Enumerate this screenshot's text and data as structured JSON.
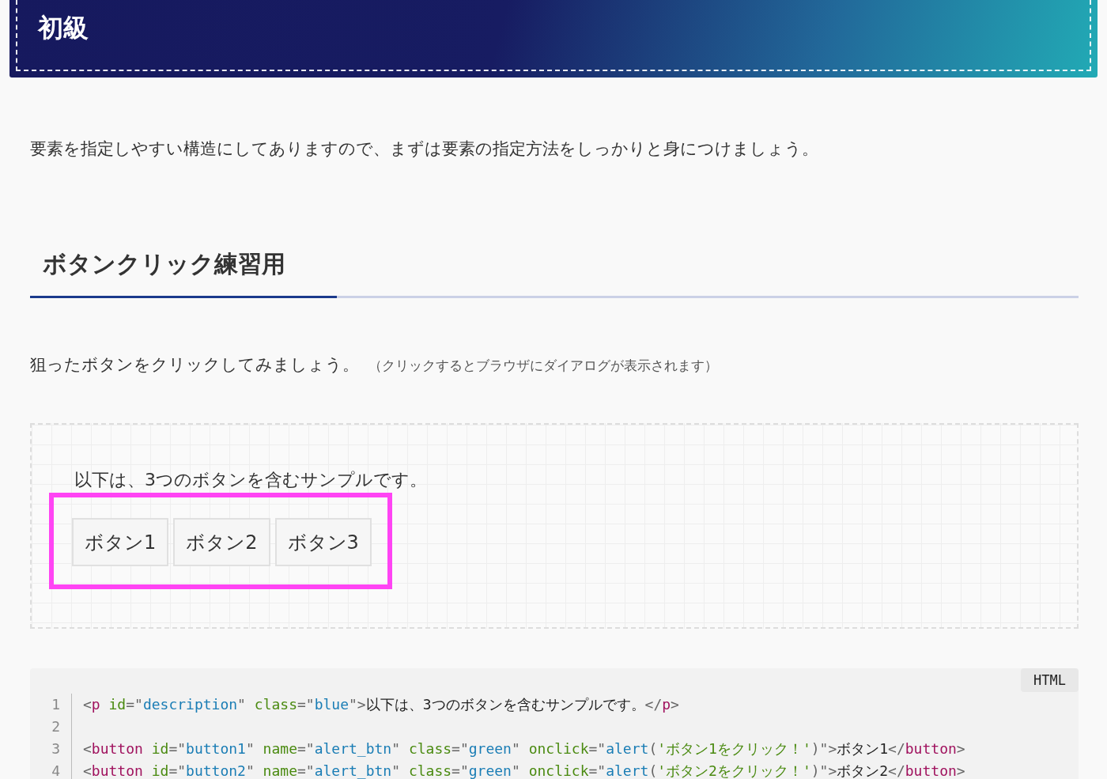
{
  "header": {
    "title": "初級"
  },
  "intro": "要素を指定しやすい構造にしてありますので、まずは要素の指定方法をしっかりと身につけましょう。",
  "section": {
    "heading": "ボタンクリック練習用",
    "instruction": "狙ったボタンをクリックしてみましょう。",
    "note": "（クリックするとブラウザにダイアログが表示されます）"
  },
  "demo": {
    "description": "以下は、3つのボタンを含むサンプルです。",
    "buttons": [
      "ボタン1",
      "ボタン2",
      "ボタン3"
    ]
  },
  "code": {
    "language": "HTML",
    "lines": [
      {
        "number": "1",
        "tokens": [
          {
            "kind": "punct",
            "t": "<"
          },
          {
            "kind": "tag",
            "t": "p"
          },
          {
            "kind": "attr",
            "t": " id"
          },
          {
            "kind": "punct",
            "t": "=\""
          },
          {
            "kind": "str",
            "t": "description"
          },
          {
            "kind": "punct",
            "t": "\""
          },
          {
            "kind": "attr",
            "t": " class"
          },
          {
            "kind": "punct",
            "t": "=\""
          },
          {
            "kind": "str",
            "t": "blue"
          },
          {
            "kind": "punct",
            "t": "\">"
          },
          {
            "kind": "text",
            "t": "以下は、3つのボタンを含むサンプルです。"
          },
          {
            "kind": "punct",
            "t": "</"
          },
          {
            "kind": "tag",
            "t": "p"
          },
          {
            "kind": "punct",
            "t": ">"
          }
        ]
      },
      {
        "number": "2"
      },
      {
        "number": "3",
        "tokens": [
          {
            "kind": "punct",
            "t": "<"
          },
          {
            "kind": "tag",
            "t": "button"
          },
          {
            "kind": "attr",
            "t": " id"
          },
          {
            "kind": "punct",
            "t": "=\""
          },
          {
            "kind": "str",
            "t": "button1"
          },
          {
            "kind": "punct",
            "t": "\""
          },
          {
            "kind": "attr",
            "t": " name"
          },
          {
            "kind": "punct",
            "t": "=\""
          },
          {
            "kind": "str",
            "t": "alert_btn"
          },
          {
            "kind": "punct",
            "t": "\""
          },
          {
            "kind": "attr",
            "t": " class"
          },
          {
            "kind": "punct",
            "t": "=\""
          },
          {
            "kind": "str",
            "t": "green"
          },
          {
            "kind": "punct",
            "t": "\""
          },
          {
            "kind": "attr",
            "t": " onclick"
          },
          {
            "kind": "punct",
            "t": "=\""
          },
          {
            "kind": "str",
            "t": "alert"
          },
          {
            "kind": "punct",
            "t": "("
          },
          {
            "kind": "attr",
            "t": "'ボタン1をクリック！'"
          },
          {
            "kind": "punct",
            "t": ")\">"
          },
          {
            "kind": "text",
            "t": "ボタン1"
          },
          {
            "kind": "punct",
            "t": "</"
          },
          {
            "kind": "tag",
            "t": "button"
          },
          {
            "kind": "punct",
            "t": ">"
          }
        ]
      },
      {
        "number": "4",
        "tokens": [
          {
            "kind": "punct",
            "t": "<"
          },
          {
            "kind": "tag",
            "t": "button"
          },
          {
            "kind": "attr",
            "t": " id"
          },
          {
            "kind": "punct",
            "t": "=\""
          },
          {
            "kind": "str",
            "t": "button2"
          },
          {
            "kind": "punct",
            "t": "\""
          },
          {
            "kind": "attr",
            "t": " name"
          },
          {
            "kind": "punct",
            "t": "=\""
          },
          {
            "kind": "str",
            "t": "alert_btn"
          },
          {
            "kind": "punct",
            "t": "\""
          },
          {
            "kind": "attr",
            "t": " class"
          },
          {
            "kind": "punct",
            "t": "=\""
          },
          {
            "kind": "str",
            "t": "green"
          },
          {
            "kind": "punct",
            "t": "\""
          },
          {
            "kind": "attr",
            "t": " onclick"
          },
          {
            "kind": "punct",
            "t": "=\""
          },
          {
            "kind": "str",
            "t": "alert"
          },
          {
            "kind": "punct",
            "t": "("
          },
          {
            "kind": "attr",
            "t": "'ボタン2をクリック！'"
          },
          {
            "kind": "punct",
            "t": ")\">"
          },
          {
            "kind": "text",
            "t": "ボタン2"
          },
          {
            "kind": "punct",
            "t": "</"
          },
          {
            "kind": "tag",
            "t": "button"
          },
          {
            "kind": "punct",
            "t": ">"
          }
        ]
      }
    ]
  }
}
